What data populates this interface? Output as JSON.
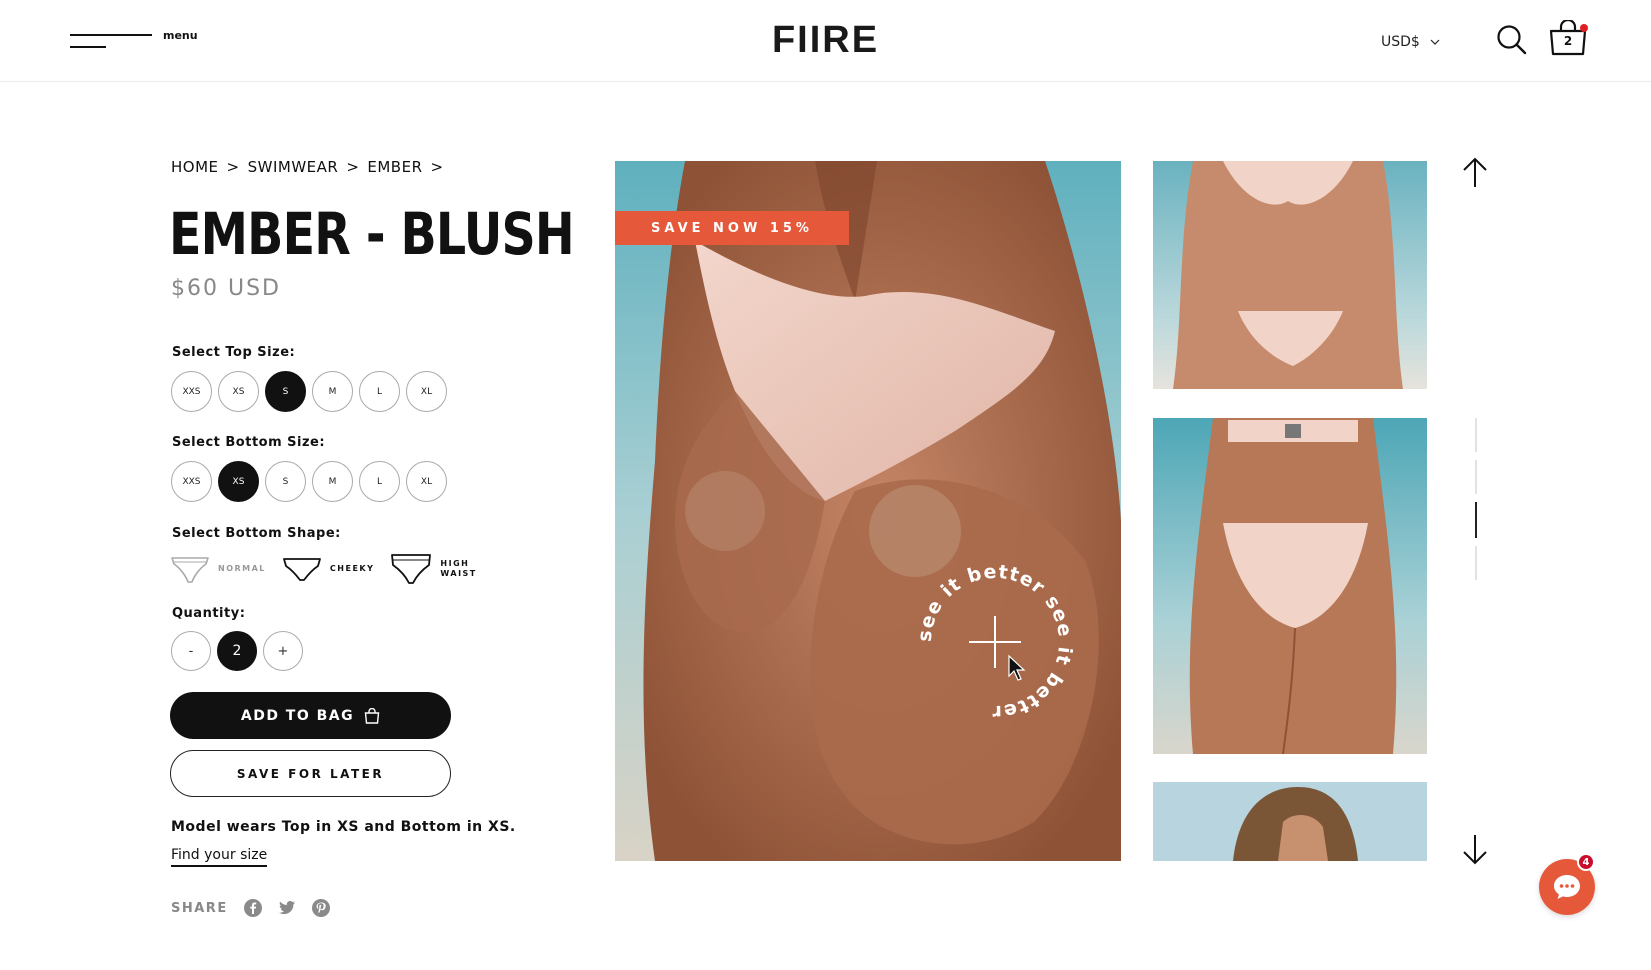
{
  "header": {
    "menu_label": "menu",
    "logo": "FIIRE",
    "currency": "USD$",
    "bag_count": "2"
  },
  "breadcrumb": [
    "HOME",
    "SWIMWEAR",
    "EMBER"
  ],
  "breadcrumb_sep": ">",
  "product": {
    "title": "EMBER - BLUSH",
    "price": "$60 USD",
    "sale_tag": "SAVE NOW 15%",
    "model_note": "Model wears Top in XS and Bottom in XS.",
    "find_size": "Find your size"
  },
  "top_size": {
    "label": "Select Top Size:",
    "options": [
      "XXS",
      "XS",
      "S",
      "M",
      "L",
      "XL"
    ],
    "selected": "S"
  },
  "bottom_size": {
    "label": "Select Bottom Size:",
    "options": [
      "XXS",
      "XS",
      "S",
      "M",
      "L",
      "XL"
    ],
    "selected": "XS"
  },
  "bottom_shape": {
    "label": "Select Bottom Shape:",
    "options": [
      {
        "name": "NORMAL",
        "line2": ""
      },
      {
        "name": "CHEEKY",
        "line2": ""
      },
      {
        "name": "HIGH",
        "line2": "WAIST"
      }
    ]
  },
  "quantity": {
    "label": "Quantity:",
    "minus": "-",
    "value": "2",
    "plus": "+"
  },
  "actions": {
    "add_to_bag": "ADD TO BAG",
    "save_for_later": "SAVE FOR LATER"
  },
  "share": {
    "label": "SHARE",
    "icons": [
      "facebook-icon",
      "twitter-icon",
      "pinterest-icon"
    ]
  },
  "image_badge": {
    "text": "see it better see it better "
  },
  "chat": {
    "unread": "4"
  },
  "colors": {
    "accent": "#e5583a",
    "dark": "#111111",
    "muted": "#888888",
    "badge": "#c8102e"
  }
}
